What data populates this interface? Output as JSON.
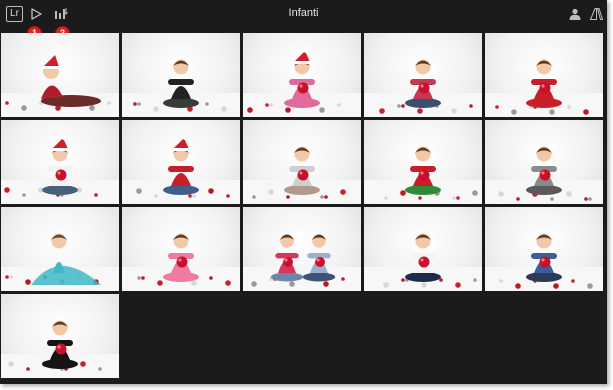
{
  "app": {
    "logo_text": "Lr",
    "title": "Infanti"
  },
  "toolbar": {
    "icons": [
      "play-icon",
      "sort-icon",
      "user-icon",
      "adobe-icon"
    ],
    "callouts": [
      {
        "label": "1"
      },
      {
        "label": "2"
      }
    ]
  },
  "colors": {
    "background": "#1b1b1b",
    "badge": "#e41f1f",
    "title_text": "#e6e6e6"
  },
  "photos": [
    {
      "name": "photo-1",
      "outfit": "#b01e2e",
      "legs": "#6a2b2b",
      "hat": "#d21d2a",
      "ball": false,
      "pose": "lying"
    },
    {
      "name": "photo-2",
      "outfit": "#222222",
      "legs": "#3a3a3a",
      "hat": "",
      "ball": false,
      "pose": "sit"
    },
    {
      "name": "photo-3",
      "outfit": "#e06a9a",
      "legs": "#e06a9a",
      "hat": "#d21d2a",
      "ball": true,
      "pose": "sit"
    },
    {
      "name": "photo-4",
      "outfit": "#c23a55",
      "legs": "#3b4f6e",
      "hat": "",
      "ball": true,
      "pose": "sit"
    },
    {
      "name": "photo-5",
      "outfit": "#c81e2a",
      "legs": "#c81e2a",
      "hat": "",
      "ball": true,
      "pose": "sit"
    },
    {
      "name": "photo-6",
      "outfit": "#f2f2f2",
      "legs": "#4a5f80",
      "hat": "#d21d2a",
      "ball": true,
      "pose": "sit"
    },
    {
      "name": "photo-7",
      "outfit": "#c81e2a",
      "legs": "#3f5f8a",
      "hat": "#d21d2a",
      "ball": false,
      "pose": "sit"
    },
    {
      "name": "photo-8",
      "outfit": "#cfcfcf",
      "legs": "#b09a8a",
      "hat": "",
      "ball": true,
      "pose": "sit"
    },
    {
      "name": "photo-9",
      "outfit": "#c81e2a",
      "legs": "#2f8a3a",
      "hat": "",
      "ball": true,
      "pose": "sit"
    },
    {
      "name": "photo-10",
      "outfit": "#8a8a8a",
      "legs": "#5a5a5a",
      "hat": "",
      "ball": true,
      "pose": "sit"
    },
    {
      "name": "photo-11",
      "outfit": "#3fb8c8",
      "legs": "#3fb8c8",
      "hat": "",
      "ball": false,
      "pose": "dress"
    },
    {
      "name": "photo-12",
      "outfit": "#f07aa0",
      "legs": "#f07aa0",
      "hat": "",
      "ball": true,
      "pose": "sit"
    },
    {
      "name": "photo-13",
      "outfit": "#d8355a",
      "legs": "#6d86a8",
      "hat": "",
      "ball": true,
      "pose": "pair"
    },
    {
      "name": "photo-14",
      "outfit": "#f4f4f4",
      "legs": "#1e2a4a",
      "hat": "",
      "ball": true,
      "pose": "sit"
    },
    {
      "name": "photo-15",
      "outfit": "#3c5e9a",
      "legs": "#2b3b58",
      "hat": "",
      "ball": true,
      "pose": "sit"
    },
    {
      "name": "photo-16",
      "outfit": "#151515",
      "legs": "#151515",
      "hat": "",
      "ball": true,
      "pose": "sit"
    }
  ]
}
